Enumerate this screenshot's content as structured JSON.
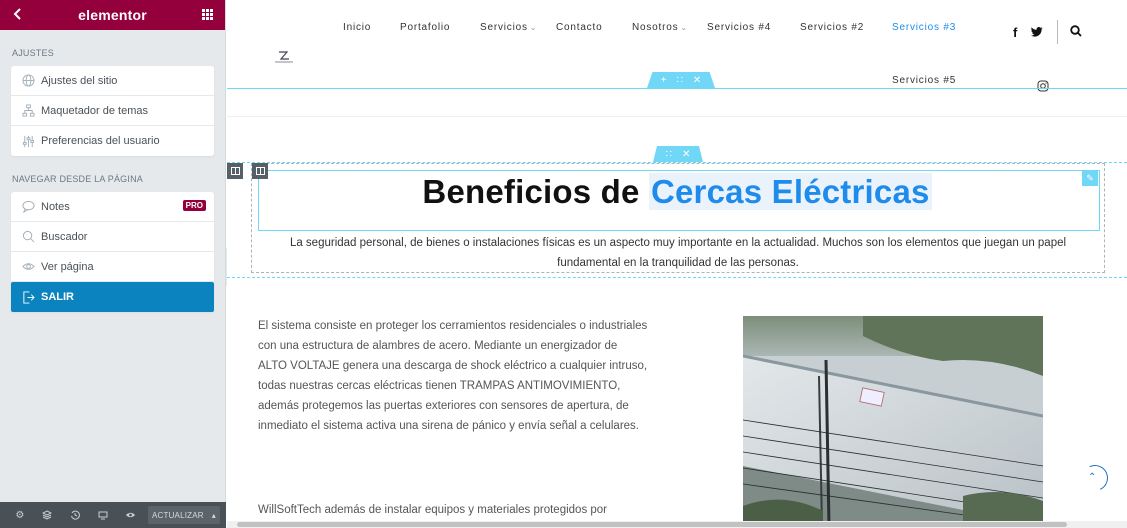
{
  "sidebar": {
    "brand": "elementor",
    "section_settings": "AJUSTES",
    "settings_items": [
      {
        "label": "Ajustes del sitio",
        "icon": "globe-icon"
      },
      {
        "label": "Maquetador de temas",
        "icon": "sitemap-icon"
      },
      {
        "label": "Preferencias del usuario",
        "icon": "sliders-icon"
      }
    ],
    "section_nav": "NAVEGAR DESDE LA PÁGINA",
    "nav_items": [
      {
        "label": "Notes",
        "icon": "chat-bubble-icon",
        "badge": "PRO"
      },
      {
        "label": "Buscador",
        "icon": "search-icon"
      },
      {
        "label": "Ver página",
        "icon": "eye-icon"
      },
      {
        "label": "SALIR",
        "icon": "exit-icon"
      }
    ],
    "footer": {
      "update_label": "ACTUALIZAR"
    }
  },
  "site_nav": {
    "links": [
      "Inicio",
      "Portafolio",
      "Servicios",
      "Contacto",
      "Nosotros",
      "Servicios #4",
      "Servicios #2",
      "Servicios #3"
    ],
    "active_link": "Servicios #3",
    "second_row_link": "Servicios #5"
  },
  "content": {
    "heading_plain": "Beneficios de ",
    "heading_highlight": "Cercas Eléctricas",
    "intro": "La seguridad personal, de bienes o instalaciones físicas es un aspecto muy importante en la actualidad. Muchos son los elementos que juegan un papel fundamental en la tranquilidad de las personas.",
    "body_lines": [
      "El sistema consiste en proteger los cerramientos residenciales o industriales",
      "con una estructura de alambres de acero. Mediante un energizador de",
      "ALTO VOLTAJE genera una descarga de shock eléctrico a cualquier intruso,",
      "todas nuestras cercas eléctricas tienen TRAMPAS ANTIMOVIMIENTO,",
      "además protegemos las puertas exteriores con sensores de apertura, de",
      "inmediato el sistema activa una sirena de pánico y envía señal a celulares."
    ],
    "body2": "WillSoftTech además de instalar equipos y materiales protegidos por"
  },
  "colors": {
    "brand": "#93003c",
    "accent": "#1f8ceb",
    "editor_blue": "#71d7f7",
    "active_item": "#0a83bf"
  }
}
